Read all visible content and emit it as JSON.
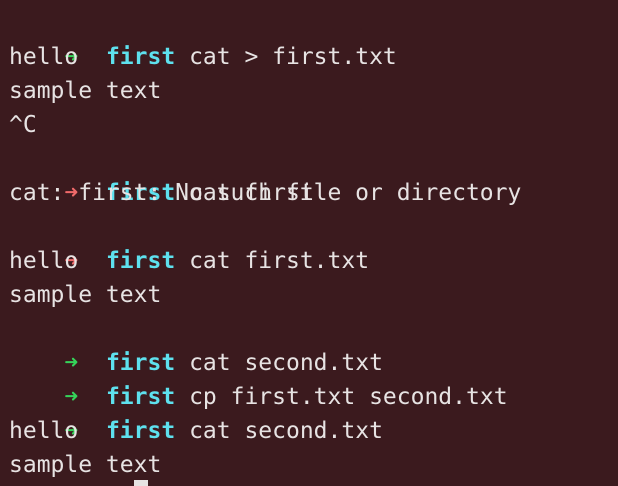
{
  "theme": {
    "background": "#3b1a1e",
    "text": "#e7e3e3",
    "prompt_success": "#35d45a",
    "prompt_error": "#f06a6a",
    "directory": "#5ee1ee"
  },
  "prompt_symbol": "➜",
  "lines": [
    {
      "type": "prompt",
      "status": "success",
      "dir": "first",
      "cmd": "cat > first.txt"
    },
    {
      "type": "output",
      "text": "hello"
    },
    {
      "type": "output",
      "text": "sample text"
    },
    {
      "type": "output",
      "text": "^C"
    },
    {
      "type": "prompt",
      "status": "error",
      "dir": "first",
      "cmd": "cat first"
    },
    {
      "type": "output",
      "text": "cat: first: No such file or directory"
    },
    {
      "type": "prompt",
      "status": "error",
      "dir": "first",
      "cmd": "cat first.txt"
    },
    {
      "type": "output",
      "text": "hello"
    },
    {
      "type": "output",
      "text": "sample text"
    },
    {
      "type": "prompt",
      "status": "success",
      "dir": "first",
      "cmd": "cat second.txt"
    },
    {
      "type": "prompt",
      "status": "success",
      "dir": "first",
      "cmd": "cp first.txt second.txt"
    },
    {
      "type": "prompt",
      "status": "success",
      "dir": "first",
      "cmd": "cat second.txt"
    },
    {
      "type": "output",
      "text": "hello"
    },
    {
      "type": "output",
      "text": "sample text"
    }
  ]
}
